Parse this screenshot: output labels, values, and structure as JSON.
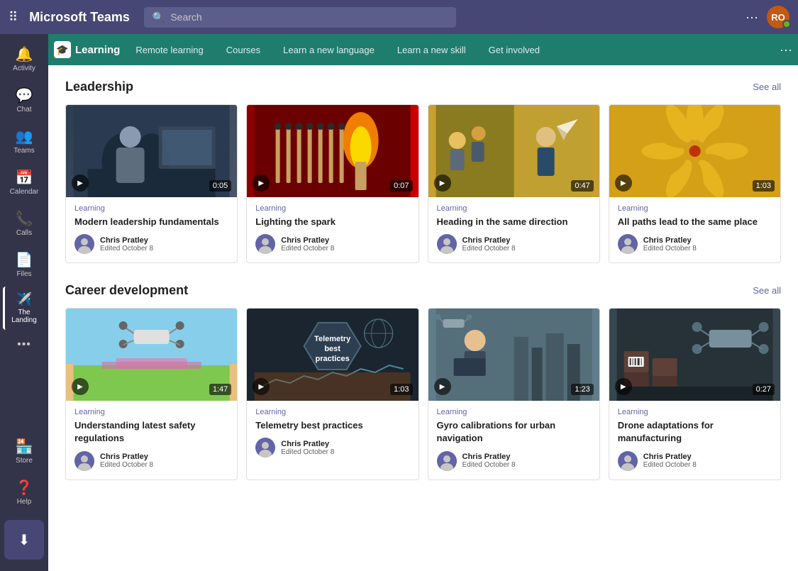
{
  "app": {
    "title": "Microsoft Teams",
    "search_placeholder": "Search"
  },
  "user": {
    "initials": "RO",
    "status": "available"
  },
  "channel": {
    "name": "Learning",
    "tabs": [
      {
        "id": "remote-learning",
        "label": "Remote learning"
      },
      {
        "id": "courses",
        "label": "Courses"
      },
      {
        "id": "learn-new-language",
        "label": "Learn a new language"
      },
      {
        "id": "learn-new-skill",
        "label": "Learn a new skill"
      },
      {
        "id": "get-involved",
        "label": "Get involved"
      }
    ]
  },
  "sidebar": {
    "items": [
      {
        "id": "activity",
        "label": "Activity",
        "icon": "🔔"
      },
      {
        "id": "chat",
        "label": "Chat",
        "icon": "💬"
      },
      {
        "id": "teams",
        "label": "Teams",
        "icon": "👥"
      },
      {
        "id": "calendar",
        "label": "Calendar",
        "icon": "📅"
      },
      {
        "id": "calls",
        "label": "Calls",
        "icon": "📞"
      },
      {
        "id": "files",
        "label": "Files",
        "icon": "📄"
      },
      {
        "id": "the-landing",
        "label": "The Landing",
        "icon": "✈️"
      },
      {
        "id": "more",
        "label": "...",
        "icon": "···"
      },
      {
        "id": "store",
        "label": "Store",
        "icon": "🏪"
      },
      {
        "id": "help",
        "label": "Help",
        "icon": "❓"
      }
    ]
  },
  "sections": [
    {
      "id": "leadership",
      "title": "Leadership",
      "see_all": "See all",
      "cards": [
        {
          "id": "card-1",
          "tag": "Learning",
          "title": "Modern leadership fundamentals",
          "author": "Chris Pratley",
          "date": "Edited October 8",
          "duration": "0:05",
          "thumb_type": "dark-meeting"
        },
        {
          "id": "card-2",
          "tag": "Learning",
          "title": "Lighting the spark",
          "author": "Chris Pratley",
          "date": "Edited October 8",
          "duration": "0:07",
          "thumb_type": "fire"
        },
        {
          "id": "card-3",
          "tag": "Learning",
          "title": "Heading in the same direction",
          "author": "Chris Pratley",
          "date": "Edited October 8",
          "duration": "0:47",
          "thumb_type": "office"
        },
        {
          "id": "card-4",
          "tag": "Learning",
          "title": "All paths lead to the same place",
          "author": "Chris Pratley",
          "date": "Edited October 8",
          "duration": "1:03",
          "thumb_type": "yellow-art"
        }
      ]
    },
    {
      "id": "career-development",
      "title": "Career development",
      "see_all": "See all",
      "cards": [
        {
          "id": "card-5",
          "tag": "Learning",
          "title": "Understanding latest safety regulations",
          "author": "Chris Pratley",
          "date": "Edited October 8",
          "duration": "1:47",
          "thumb_type": "sky"
        },
        {
          "id": "card-6",
          "tag": "Learning",
          "title": "Telemetry best practices",
          "author": "Chris Pratley",
          "date": "Edited October 8",
          "duration": "1:03",
          "thumb_type": "telemetry"
        },
        {
          "id": "card-7",
          "tag": "Learning",
          "title": "Gyro calibrations for urban navigation",
          "author": "Chris Pratley",
          "date": "Edited October 8",
          "duration": "1:23",
          "thumb_type": "city"
        },
        {
          "id": "card-8",
          "tag": "Learning",
          "title": "Drone adaptations for manufacturing",
          "author": "Chris Pratley",
          "date": "Edited October 8",
          "duration": "0:27",
          "thumb_type": "warehouse"
        }
      ]
    }
  ],
  "colors": {
    "accent": "#6264a7",
    "teal": "#1f7d6e",
    "purple": "#464775"
  }
}
